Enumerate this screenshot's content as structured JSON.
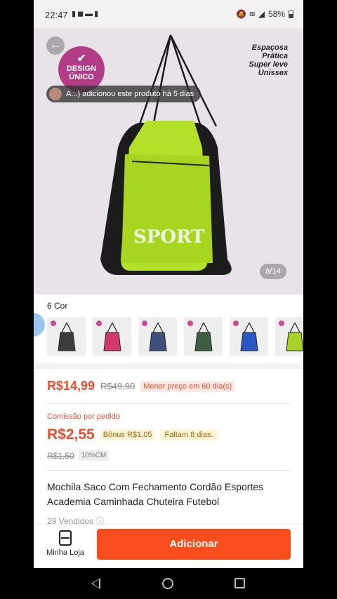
{
  "status_bar": {
    "time": "22:47",
    "battery": "58%",
    "left_icons": "▮◼▬▮",
    "right_icons": "🔕 ≋ ◢"
  },
  "hero": {
    "back_icon": "back-arrow-icon",
    "badge_line1": "DESIGN",
    "badge_line2": "ÚNICO",
    "features": [
      "Espaçosa",
      "Prática",
      "Super leve",
      "Unissex"
    ],
    "toast_text": "A...) adicionou este produto há 5 dias",
    "image_counter": "8/14",
    "bag_text": "SPORT"
  },
  "variants": {
    "label": "6 Cor",
    "colors": [
      "#3c3c3c",
      "#d33a6b",
      "#3f4f7c",
      "#3d5f3f",
      "#2a57c6",
      "#a8d22a"
    ]
  },
  "price": {
    "current": "R$14,99",
    "old": "R$49,90",
    "badge": "Menor preço em 60 dia(s)"
  },
  "commission": {
    "label": "Comissão por pedido",
    "value": "R$2,55",
    "bonus": "Bônus R$1,05",
    "deadline": "Faltam 8 dias.",
    "old_value": "R$1,50",
    "percent": "10%CM"
  },
  "product": {
    "title": "Mochila Saco Com Fechamento Cordão Esportes Academia Caminhada Chuteira Futebol",
    "sold": "29 Vendidos ⓘ"
  },
  "bottom_bar": {
    "store_label": "Minha Loja",
    "add_label": "Adicionar"
  },
  "colors": {
    "accent": "#ee4d2d",
    "button": "#f94d1d",
    "badge": "#b33c86"
  }
}
